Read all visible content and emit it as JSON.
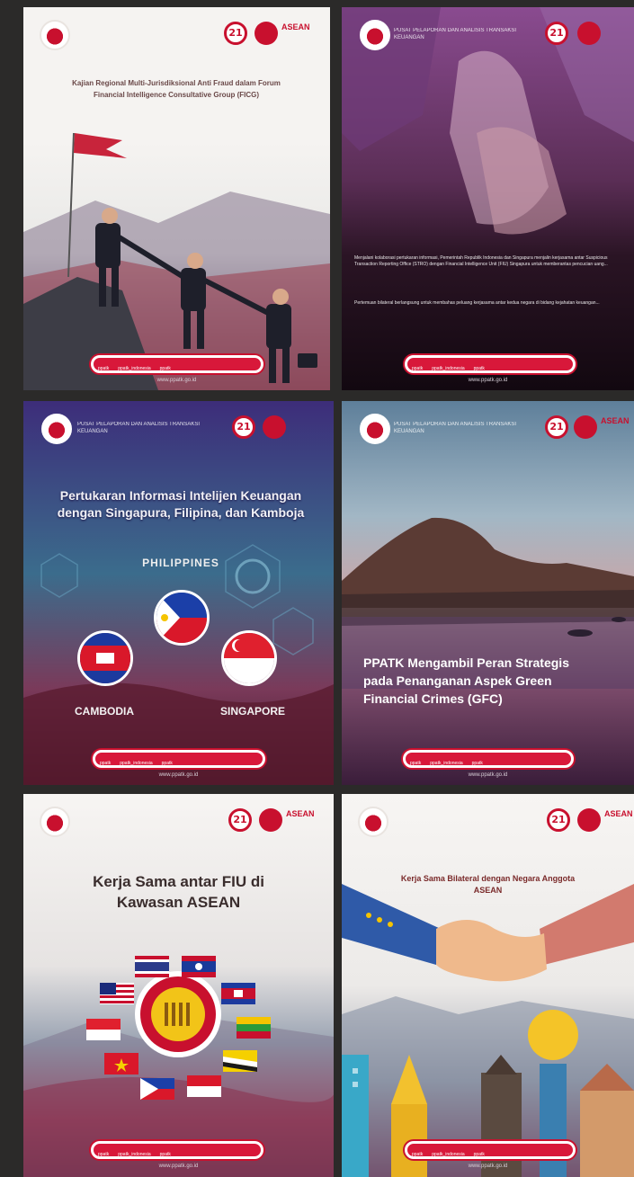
{
  "cards": [
    {
      "title": "Kajian Regional Multi-Jurisdiksional Anti Fraud dalam Forum Financial Intelligence Consultative Group (FICG)",
      "anniversary": "21",
      "asean": "ASEAN"
    },
    {
      "org": "PUSAT PELAPORAN DAN ANALISIS TRANSAKSI KEUANGAN",
      "anniversary": "21",
      "body1": "Menjalani kolaborasi pertukaran informasi, Pemerintah Republik Indonesia dan Singapura menjalin kerjasama antar Suspicious Transaction Reporting Office (STRO) dengan Financial Intelligence Unit (FIU) Singapura untuk memberantas pencucian uang...",
      "body2": "Pertemuan bilateral berlangsung untuk membahas peluang kerjasama antar kedua negara di bidang kejahatan keuangan..."
    },
    {
      "org": "PUSAT PELAPORAN DAN ANALISIS TRANSAKSI KEUANGAN",
      "anniversary": "21",
      "title": "Pertukaran Informasi Intelijen Keuangan dengan Singapura, Filipina, dan Kamboja",
      "countries": {
        "philippines": "PHILIPPINES",
        "cambodia": "CAMBODIA",
        "singapore": "SINGAPORE"
      }
    },
    {
      "org": "PUSAT PELAPORAN DAN ANALISIS TRANSAKSI KEUANGAN",
      "anniversary": "21",
      "asean": "ASEAN",
      "title": "PPATK Mengambil Peran Strategis pada Penanganan Aspek Green Financial Crimes (GFC)"
    },
    {
      "anniversary": "21",
      "asean": "ASEAN",
      "title": "Kerja Sama antar FIU di Kawasan ASEAN"
    },
    {
      "anniversary": "21",
      "asean": "ASEAN",
      "title": "Kerja Sama Bilateral dengan Negara Anggota ASEAN"
    }
  ],
  "social": [
    "ppatk",
    "ppatk_indonesia",
    "ppatk"
  ],
  "site": "www.ppatk.go.id",
  "colors": {
    "brand_red": "#c8102e",
    "background": "#2b2a29"
  }
}
